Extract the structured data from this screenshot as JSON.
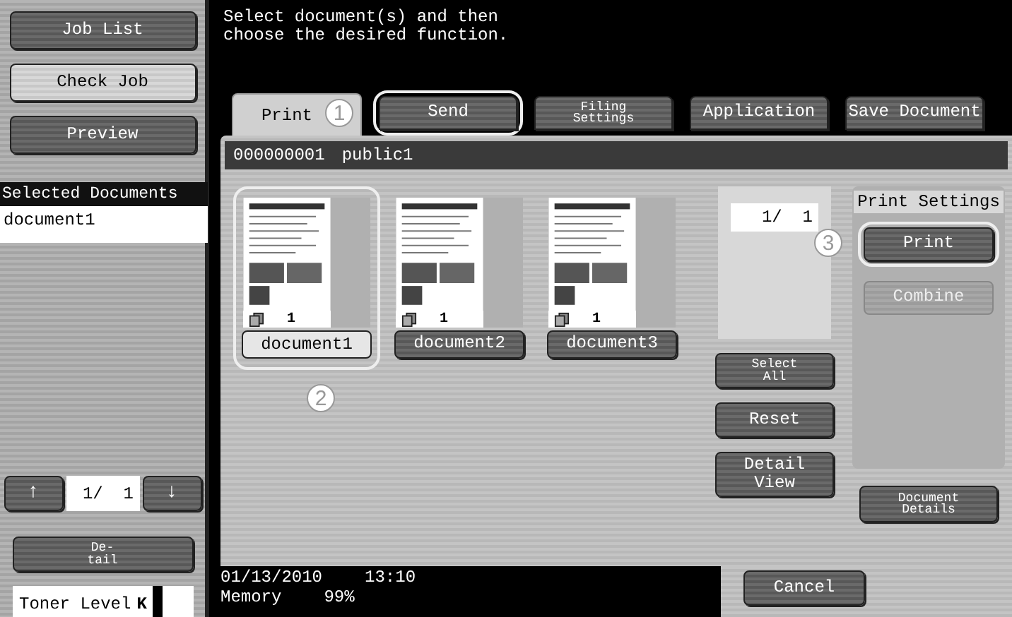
{
  "sidebar": {
    "buttons": [
      {
        "label": "Job List",
        "selected": false
      },
      {
        "label": "Check Job",
        "selected": true
      },
      {
        "label": "Preview",
        "selected": false
      }
    ],
    "selected_documents": {
      "title": "Selected Documents",
      "items": [
        "document1"
      ]
    },
    "pager": {
      "up": "↑",
      "page": "1/  1",
      "down": "↓"
    },
    "detail_button": "De-\ntail",
    "toner": {
      "label": "Toner Level",
      "color_label": "K",
      "level": 1
    }
  },
  "instruction": "Select document(s) and then\nchoose the desired function.",
  "tabs": [
    {
      "label": "Print",
      "selected": true,
      "small": false,
      "highlighted": false,
      "callout": "1"
    },
    {
      "label": "Send",
      "selected": false,
      "small": false,
      "highlighted": true
    },
    {
      "label": "Filing\nSettings",
      "selected": false,
      "small": true,
      "highlighted": false
    },
    {
      "label": "Application",
      "selected": false,
      "small": false,
      "highlighted": false
    },
    {
      "label": "Save Document",
      "selected": false,
      "small": false,
      "highlighted": false
    }
  ],
  "box_bar": {
    "number": "000000001",
    "name": "public1"
  },
  "documents": [
    {
      "name": "document1",
      "copies": "1",
      "selected": true,
      "highlighted": true
    },
    {
      "name": "document2",
      "copies": "1",
      "selected": false,
      "highlighted": false
    },
    {
      "name": "document3",
      "copies": "1",
      "selected": false,
      "highlighted": false
    }
  ],
  "document_callout": "2",
  "page_counter": "1/  1",
  "counter_callout": "3",
  "actions": [
    {
      "label": "Select\nAll",
      "small": true
    },
    {
      "label": "Reset",
      "small": false
    },
    {
      "label": "Detail\nView",
      "small": false
    }
  ],
  "print_settings": {
    "title": "Print Settings",
    "buttons": [
      {
        "label": "Print",
        "disabled": false,
        "highlighted": true
      },
      {
        "label": "Combine",
        "disabled": true,
        "highlighted": false
      }
    ]
  },
  "document_details_button": "Document\nDetails",
  "status": {
    "date": "01/13/2010",
    "time": "13:10",
    "memory_label": "Memory",
    "memory": "99%"
  },
  "cancel_button": "Cancel"
}
